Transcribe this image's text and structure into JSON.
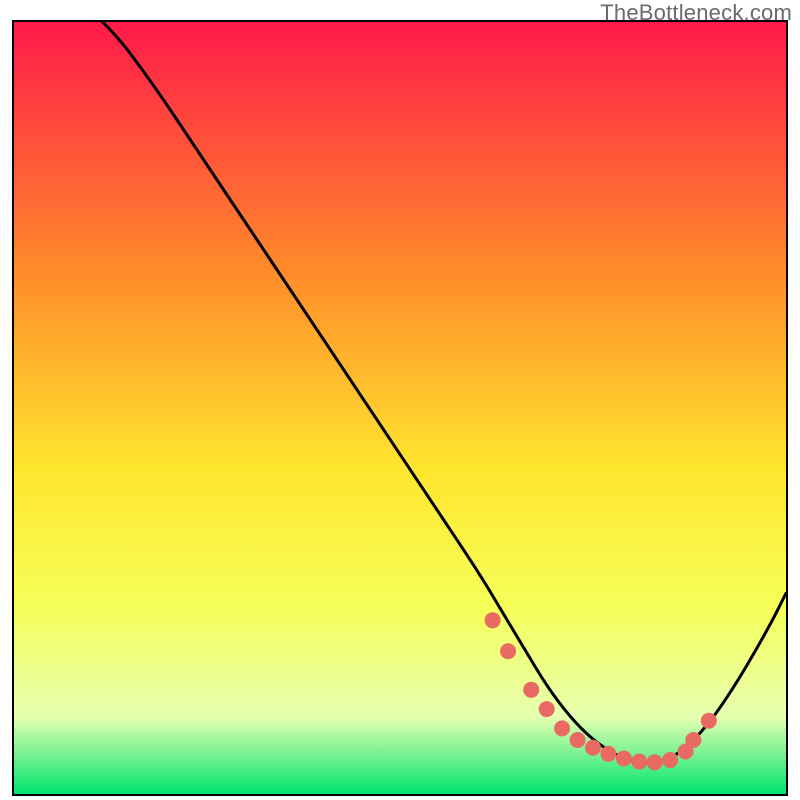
{
  "watermark": "TheBottleneck.com",
  "colors": {
    "grad_top": "#ff1a4a",
    "grad_mid1": "#ff8a2a",
    "grad_mid2": "#ffe62e",
    "grad_mid3": "#f6ff5a",
    "grad_mid4": "#e6ffb0",
    "grad_bottom": "#00e470",
    "curve": "#000000",
    "marker_fill": "#e96a62",
    "marker_stroke": "#e96a62"
  },
  "chart_data": {
    "type": "line",
    "title": "",
    "xlabel": "",
    "ylabel": "",
    "xlim": [
      0,
      100
    ],
    "ylim": [
      0,
      100
    ],
    "series": [
      {
        "name": "curve",
        "x": [
          0,
          12,
          18,
          24,
          30,
          36,
          42,
          48,
          54,
          60,
          63,
          66,
          69,
          72,
          75,
          78,
          81,
          83,
          86,
          90,
          94,
          98,
          100
        ],
        "y": [
          110,
          100,
          92,
          83,
          74,
          65,
          56,
          47,
          38,
          29,
          24,
          19,
          14,
          10,
          7,
          5,
          4,
          4,
          5,
          9,
          15,
          22,
          26
        ]
      }
    ],
    "markers": {
      "name": "highlight-points",
      "x": [
        62,
        64,
        67,
        69,
        71,
        73,
        75,
        77,
        79,
        81,
        83,
        85,
        87,
        88,
        90
      ],
      "y": [
        22.5,
        18.5,
        13.5,
        11,
        8.5,
        7,
        6,
        5.2,
        4.6,
        4.2,
        4.1,
        4.4,
        5.5,
        7,
        9.5
      ]
    }
  }
}
